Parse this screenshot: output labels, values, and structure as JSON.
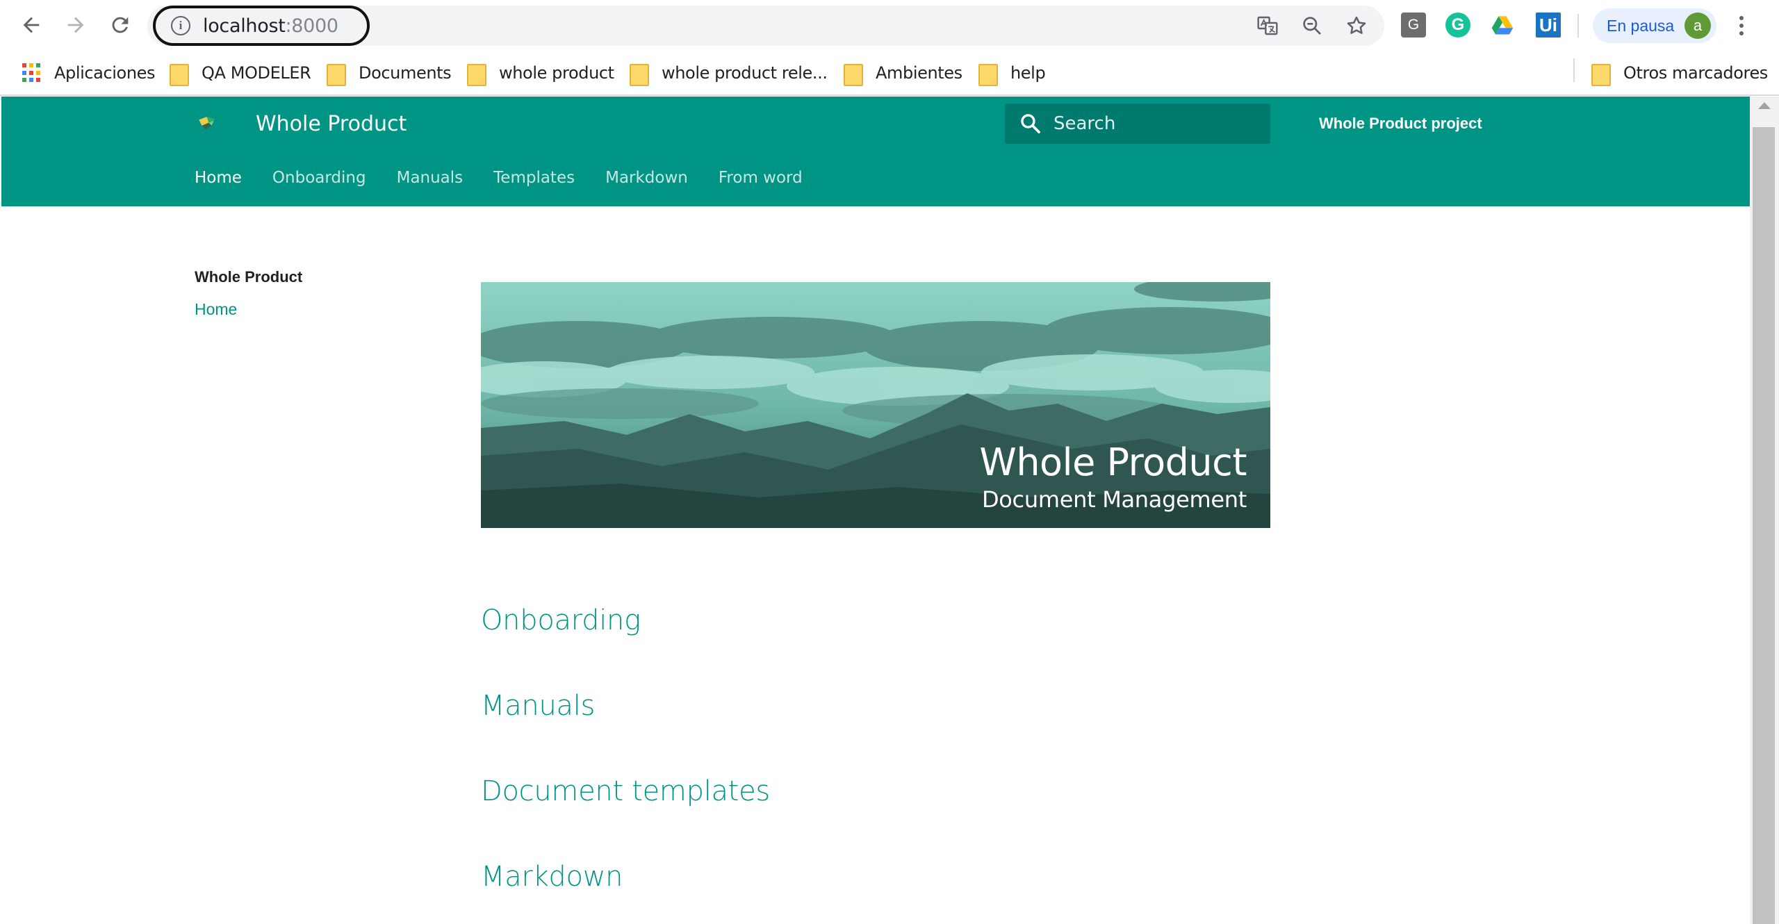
{
  "browser": {
    "url_host": "localhost",
    "url_port": ":8000",
    "profile_status": "En pausa",
    "avatar_letter": "a",
    "extensions": [
      "G",
      "G",
      "Ui"
    ]
  },
  "bookmarks": {
    "apps": "Aplicaciones",
    "items": [
      "QA MODELER",
      "Documents",
      "whole product",
      "whole product rele...",
      "Ambientes",
      "help"
    ],
    "other": "Otros marcadores"
  },
  "site": {
    "title": "Whole Product",
    "search_placeholder": "Search",
    "project_link": "Whole Product project",
    "tabs": [
      "Home",
      "Onboarding",
      "Manuals",
      "Templates",
      "Markdown",
      "From word"
    ],
    "active_tab": "Home",
    "accent_color": "#009485"
  },
  "sidebar": {
    "title": "Whole Product",
    "items": [
      "Home"
    ]
  },
  "hero": {
    "title": "Whole Product",
    "subtitle": "Document Management"
  },
  "sections": [
    "Onboarding",
    "Manuals",
    "Document templates",
    "Markdown"
  ]
}
